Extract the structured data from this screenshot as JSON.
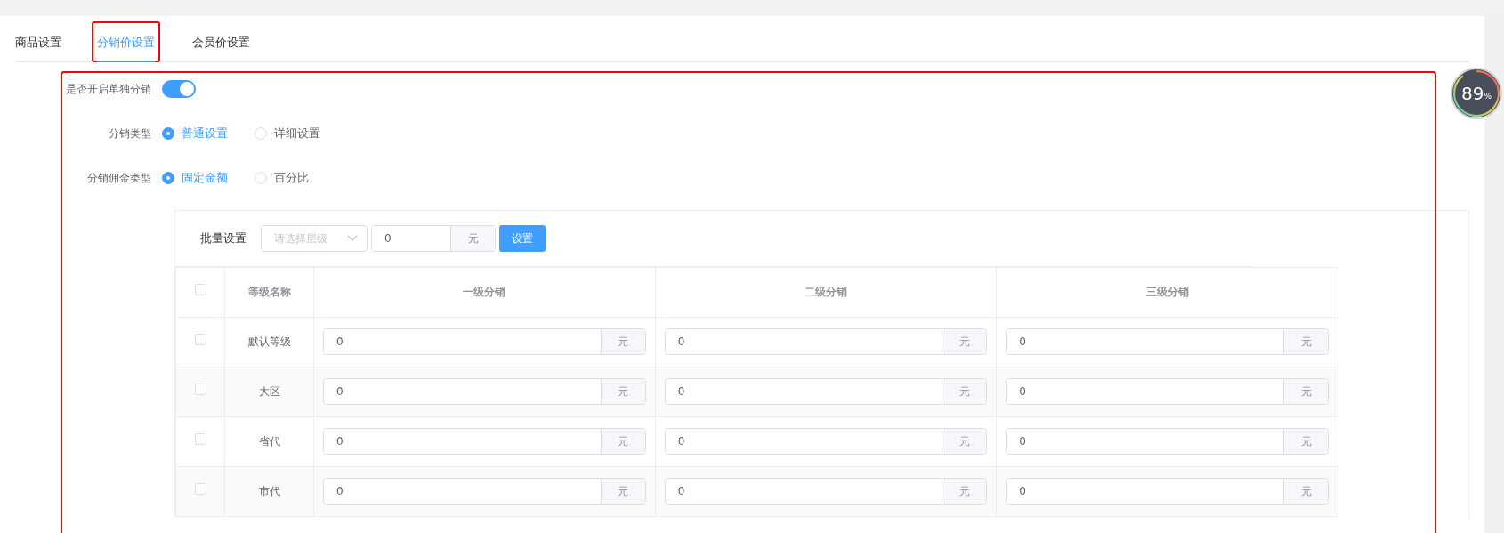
{
  "tabs": [
    {
      "label": "商品设置",
      "selected": false
    },
    {
      "label": "分销价设置",
      "selected": true,
      "highlighted": true
    },
    {
      "label": "会员价设置",
      "selected": false
    }
  ],
  "form": {
    "highlighted": true,
    "toggle": {
      "label": "是否开启单独分销",
      "on": true
    },
    "radio_groups": [
      {
        "label": "分销类型",
        "options": [
          {
            "label": "普通设置",
            "selected": true
          },
          {
            "label": "详细设置",
            "selected": false
          }
        ]
      },
      {
        "label": "分销佣金类型",
        "options": [
          {
            "label": "固定金额",
            "selected": true
          },
          {
            "label": "百分比",
            "selected": false
          }
        ]
      }
    ],
    "batch": {
      "label": "批量设置",
      "select_placeholder": "请选择层级",
      "value": "0",
      "unit": "元",
      "button": "设置"
    },
    "table": {
      "columns": [
        {
          "kind": "checkbox",
          "checked": false
        },
        {
          "kind": "text",
          "label": "等级名称"
        },
        {
          "kind": "text",
          "label": "一级分销"
        },
        {
          "kind": "text",
          "label": "二级分销"
        },
        {
          "kind": "text",
          "label": "三级分销"
        }
      ],
      "rows": [
        {
          "cells": [
            {
              "kind": "checkbox",
              "checked": false
            },
            {
              "kind": "text",
              "text": "默认等级"
            },
            {
              "kind": "amount",
              "value": "0",
              "unit": "元"
            },
            {
              "kind": "amount",
              "value": "0",
              "unit": "元"
            },
            {
              "kind": "amount",
              "value": "0",
              "unit": "元"
            }
          ]
        },
        {
          "cells": [
            {
              "kind": "checkbox",
              "checked": false
            },
            {
              "kind": "text",
              "text": "大区"
            },
            {
              "kind": "amount",
              "value": "0",
              "unit": "元"
            },
            {
              "kind": "amount",
              "value": "0",
              "unit": "元"
            },
            {
              "kind": "amount",
              "value": "0",
              "unit": "元"
            }
          ]
        },
        {
          "cells": [
            {
              "kind": "checkbox",
              "checked": false
            },
            {
              "kind": "text",
              "text": "省代"
            },
            {
              "kind": "amount",
              "value": "0",
              "unit": "元"
            },
            {
              "kind": "amount",
              "value": "0",
              "unit": "元"
            },
            {
              "kind": "amount",
              "value": "0",
              "unit": "元"
            }
          ]
        },
        {
          "cells": [
            {
              "kind": "checkbox",
              "checked": false
            },
            {
              "kind": "text",
              "text": "市代"
            },
            {
              "kind": "amount",
              "value": "0",
              "unit": "元"
            },
            {
              "kind": "amount",
              "value": "0",
              "unit": "元"
            },
            {
              "kind": "amount",
              "value": "0",
              "unit": "元"
            }
          ]
        }
      ]
    }
  },
  "widget": {
    "value": "89",
    "unit": "%"
  }
}
